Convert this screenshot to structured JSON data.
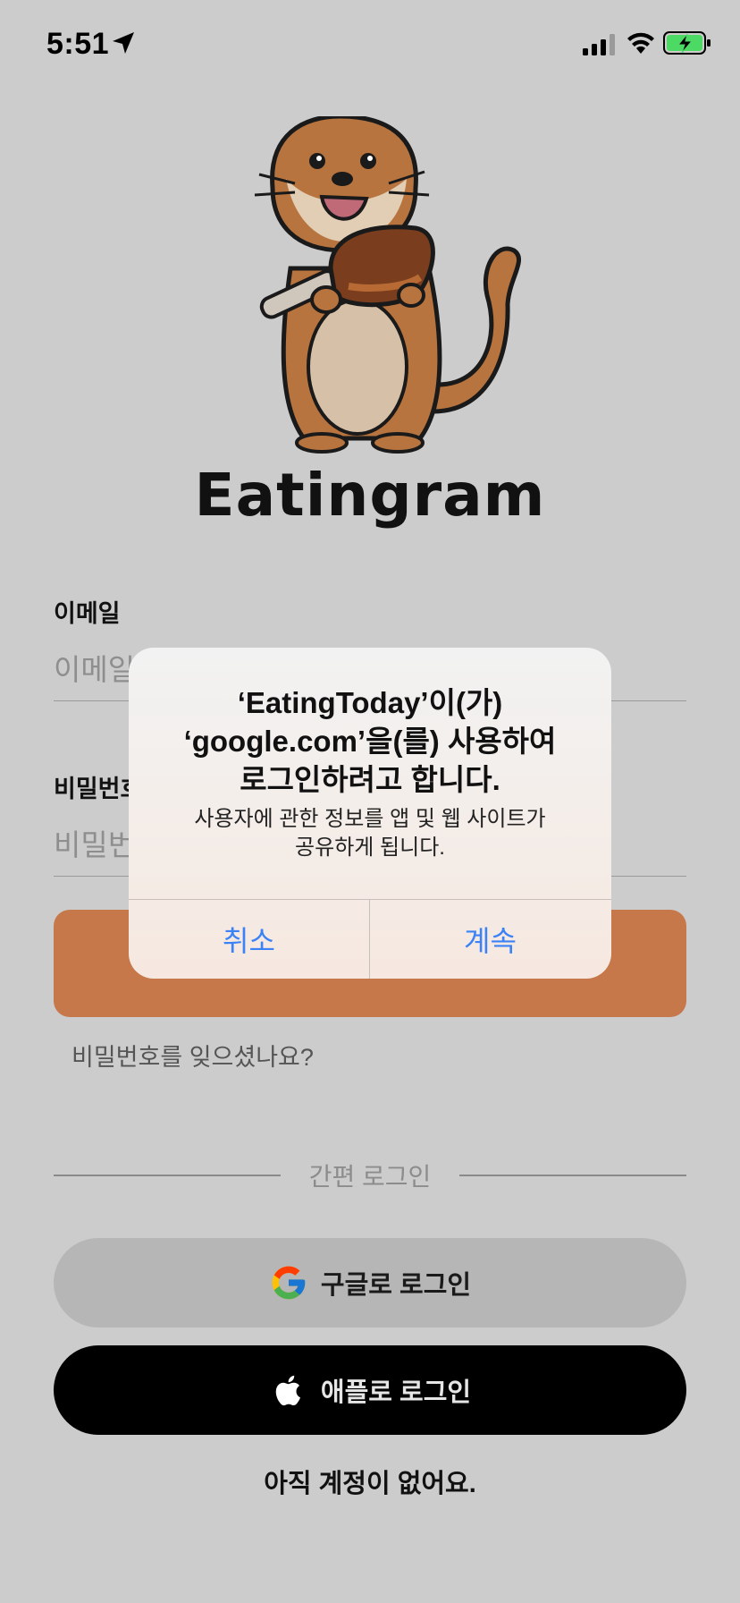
{
  "status_bar": {
    "time": "5:51",
    "icons": [
      "location-arrow-icon",
      "signal-icon",
      "wifi-icon",
      "battery-charging-icon"
    ],
    "battery_color": "#4cd964"
  },
  "app": {
    "name": "Eatingram",
    "mascot": "otter-eating-drumstick"
  },
  "form": {
    "email_label": "이메일",
    "email_placeholder": "이메일",
    "password_label": "비밀번호",
    "password_placeholder": "비밀번호",
    "login_button_color": "#c6784a",
    "forgot_password": "비밀번호를 잊으셨나요?"
  },
  "social": {
    "divider_text": "간편 로그인",
    "google_label": "구글로 로그인",
    "apple_label": "애플로 로그인",
    "signup_text": "아직 계정이 없어요."
  },
  "alert": {
    "title": "‘EatingToday’이(가)\n‘google.com’을(를) 사용하여\n로그인하려고 합니다.",
    "message": "사용자에 관한 정보를 앱 및 웹 사이트가\n공유하게 됩니다.",
    "cancel_label": "취소",
    "continue_label": "계속",
    "button_color": "#3b82f6"
  }
}
